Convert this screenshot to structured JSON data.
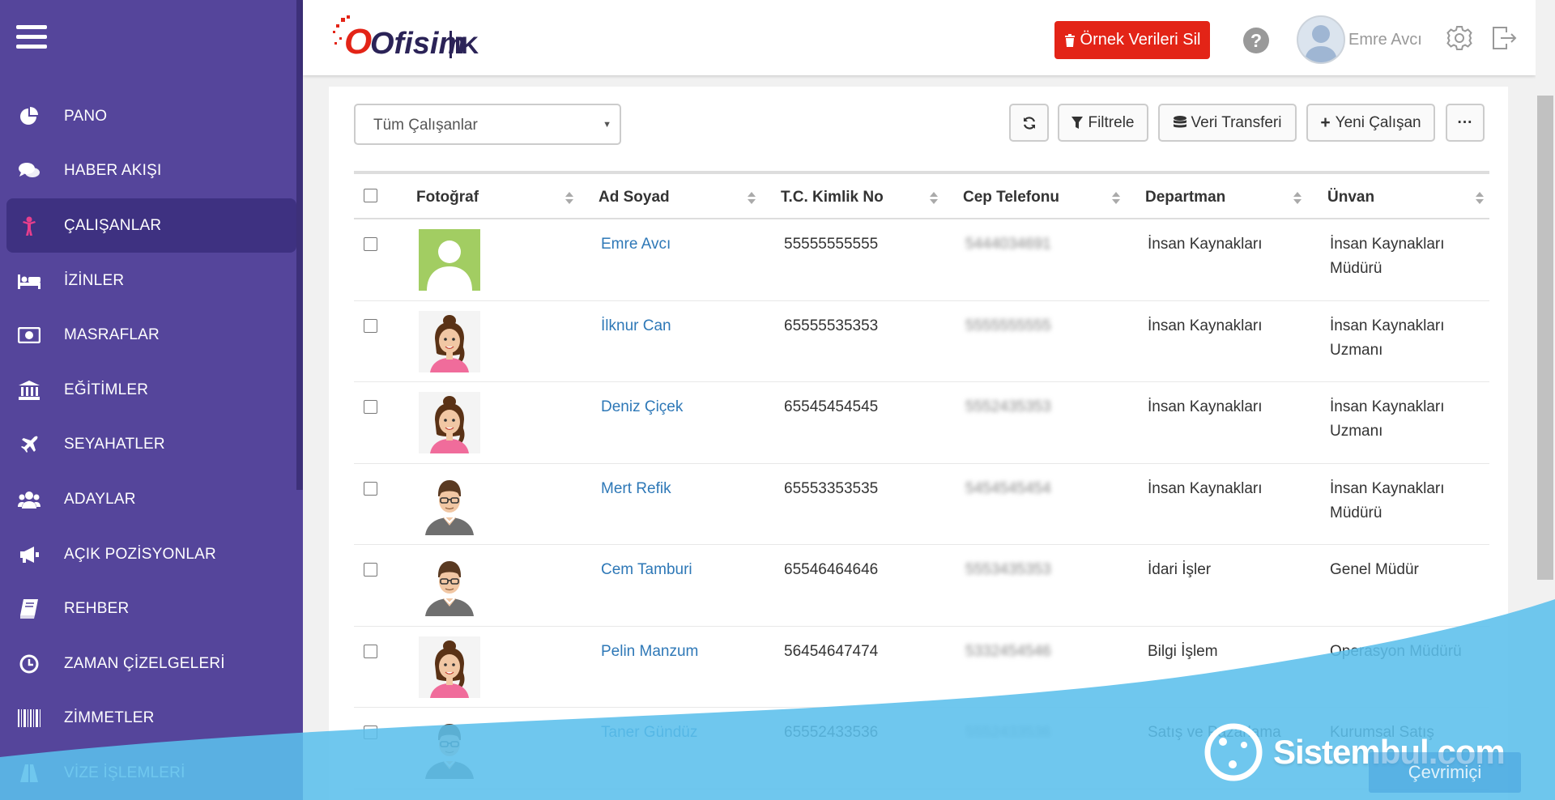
{
  "sidebar": {
    "items": [
      {
        "label": "PANO",
        "icon": "pie-chart-icon",
        "active": false
      },
      {
        "label": "HABER AKIŞI",
        "icon": "comments-icon",
        "active": false
      },
      {
        "label": "ÇALIŞANLAR",
        "icon": "person-icon",
        "active": true
      },
      {
        "label": "İZİNLER",
        "icon": "bed-icon",
        "active": false
      },
      {
        "label": "MASRAFLAR",
        "icon": "money-icon",
        "active": false
      },
      {
        "label": "EĞİTİMLER",
        "icon": "bank-icon",
        "active": false
      },
      {
        "label": "SEYAHATLER",
        "icon": "plane-icon",
        "active": false
      },
      {
        "label": "ADAYLAR",
        "icon": "users-icon",
        "active": false
      },
      {
        "label": "AÇIK POZİSYONLAR",
        "icon": "megaphone-icon",
        "active": false
      },
      {
        "label": "REHBER",
        "icon": "book-icon",
        "active": false
      },
      {
        "label": "ZAMAN ÇİZELGELERİ",
        "icon": "clock-icon",
        "active": false
      },
      {
        "label": "ZİMMETLER",
        "icon": "barcode-icon",
        "active": false
      },
      {
        "label": "VİZE İŞLEMLERİ",
        "icon": "road-icon",
        "active": false
      }
    ],
    "accent_active": "#e83e8c"
  },
  "header": {
    "logo_text": "Ofisim",
    "logo_suffix": "IK",
    "delete_button": "Örnek Verileri Sil",
    "user_name": "Emre Avcı"
  },
  "toolbar": {
    "filter_select": "Tüm Çalışanlar",
    "filter_button": "Filtrele",
    "transfer_button": "Veri Transferi",
    "new_button": "Yeni Çalışan",
    "more_button": "···"
  },
  "table": {
    "columns": [
      "Fotoğraf",
      "Ad Soyad",
      "T.C. Kimlik No",
      "Cep Telefonu",
      "Departman",
      "Ünvan"
    ],
    "rows": [
      {
        "photo": "placeholder",
        "name": "Emre Avcı",
        "tc": "55555555555",
        "phone": "5444034691",
        "dept": "İnsan Kaynakları",
        "title1": "İnsan Kaynakları",
        "title2": "Müdürü"
      },
      {
        "photo": "female",
        "name": "İlknur Can",
        "tc": "65555535353",
        "phone": "5555555555",
        "dept": "İnsan Kaynakları",
        "title1": "İnsan Kaynakları",
        "title2": "Uzmanı"
      },
      {
        "photo": "female",
        "name": "Deniz Çiçek",
        "tc": "65545454545",
        "phone": "5552435353",
        "dept": "İnsan Kaynakları",
        "title1": "İnsan Kaynakları",
        "title2": "Uzmanı"
      },
      {
        "photo": "male",
        "name": "Mert Refik",
        "tc": "65553353535",
        "phone": "5454545454",
        "dept": "İnsan Kaynakları",
        "title1": "İnsan Kaynakları",
        "title2": "Müdürü"
      },
      {
        "photo": "male",
        "name": "Cem Tamburi",
        "tc": "65546464646",
        "phone": "5553435353",
        "dept": "İdari İşler",
        "title1": "Genel Müdür",
        "title2": ""
      },
      {
        "photo": "female",
        "name": "Pelin Manzum",
        "tc": "56454647474",
        "phone": "5332454546",
        "dept": "Bilgi İşlem",
        "title1": "Operasyon Müdürü",
        "title2": ""
      },
      {
        "photo": "male",
        "name": "Taner Gündüz",
        "tc": "65552433536",
        "phone": "5552433536",
        "dept": "Satış ve Pazarlama",
        "title1": "Kurumsal Satış",
        "title2": ""
      }
    ]
  },
  "watermark": {
    "text": "Sistembul.com"
  },
  "status": {
    "online": "Çevrimiçi"
  },
  "colors": {
    "sidebar": "#55459b",
    "sidebar_active": "#3e3181",
    "danger": "#e32417",
    "link": "#2e78b7"
  }
}
